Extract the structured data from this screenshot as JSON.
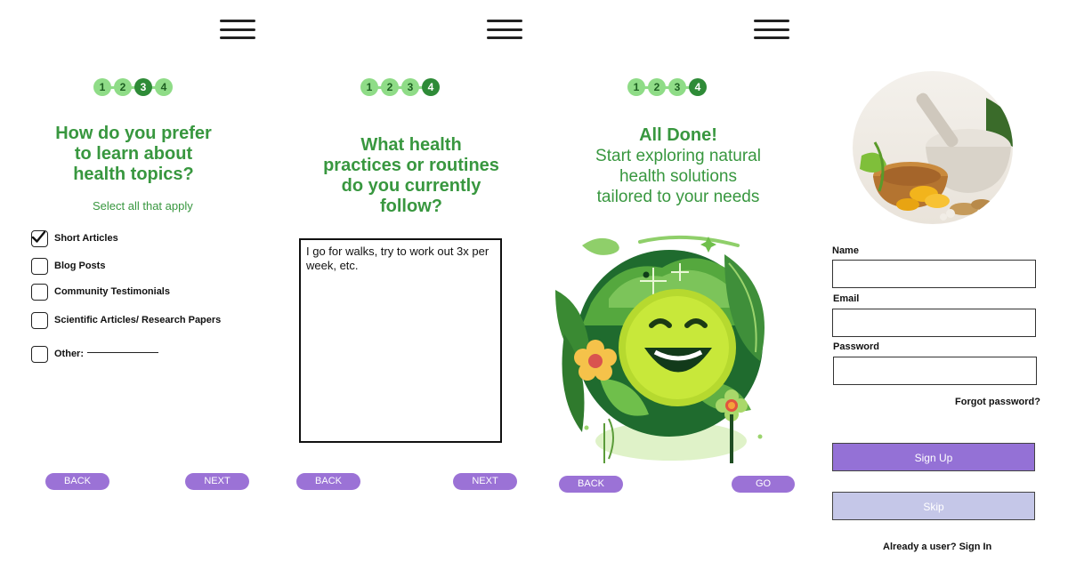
{
  "steps": [
    "1",
    "2",
    "3",
    "4"
  ],
  "screen1": {
    "title_lines": [
      "How do you prefer",
      "to learn about",
      "health topics?"
    ],
    "hint": "Select all that apply",
    "options": [
      {
        "label": "Short Articles",
        "checked": true
      },
      {
        "label": "Blog Posts",
        "checked": false
      },
      {
        "label": "Community Testimonials",
        "checked": false
      },
      {
        "label": "Scientific Articles/ Research Papers",
        "checked": false
      },
      {
        "label": "Other:",
        "checked": false
      }
    ],
    "back_label": "BACK",
    "next_label": "NEXT"
  },
  "screen2": {
    "title_lines": [
      "What health",
      "practices or routines",
      "do you currently",
      "follow?"
    ],
    "answer_text": "I go for walks, try to work out 3x per week, etc.",
    "back_label": "BACK",
    "next_label": "NEXT"
  },
  "screen3": {
    "title": "All Done!",
    "subtitle_lines": [
      "Start exploring natural",
      "health solutions",
      "tailored to your needs"
    ],
    "back_label": "BACK",
    "go_label": "GO"
  },
  "screen4": {
    "name_label": "Name",
    "email_label": "Email",
    "password_label": "Password",
    "forgot_label": "Forgot password?",
    "signup_label": "Sign Up",
    "skip_label": "Skip",
    "signin_label": "Already a user? Sign In"
  },
  "colors": {
    "green_text": "#38973f",
    "step_light": "#8fdc87",
    "step_active": "#2e8b37",
    "purple_button": "#9b72d6",
    "signup_button": "#9471d6",
    "skip_button": "#c5c7e8"
  }
}
